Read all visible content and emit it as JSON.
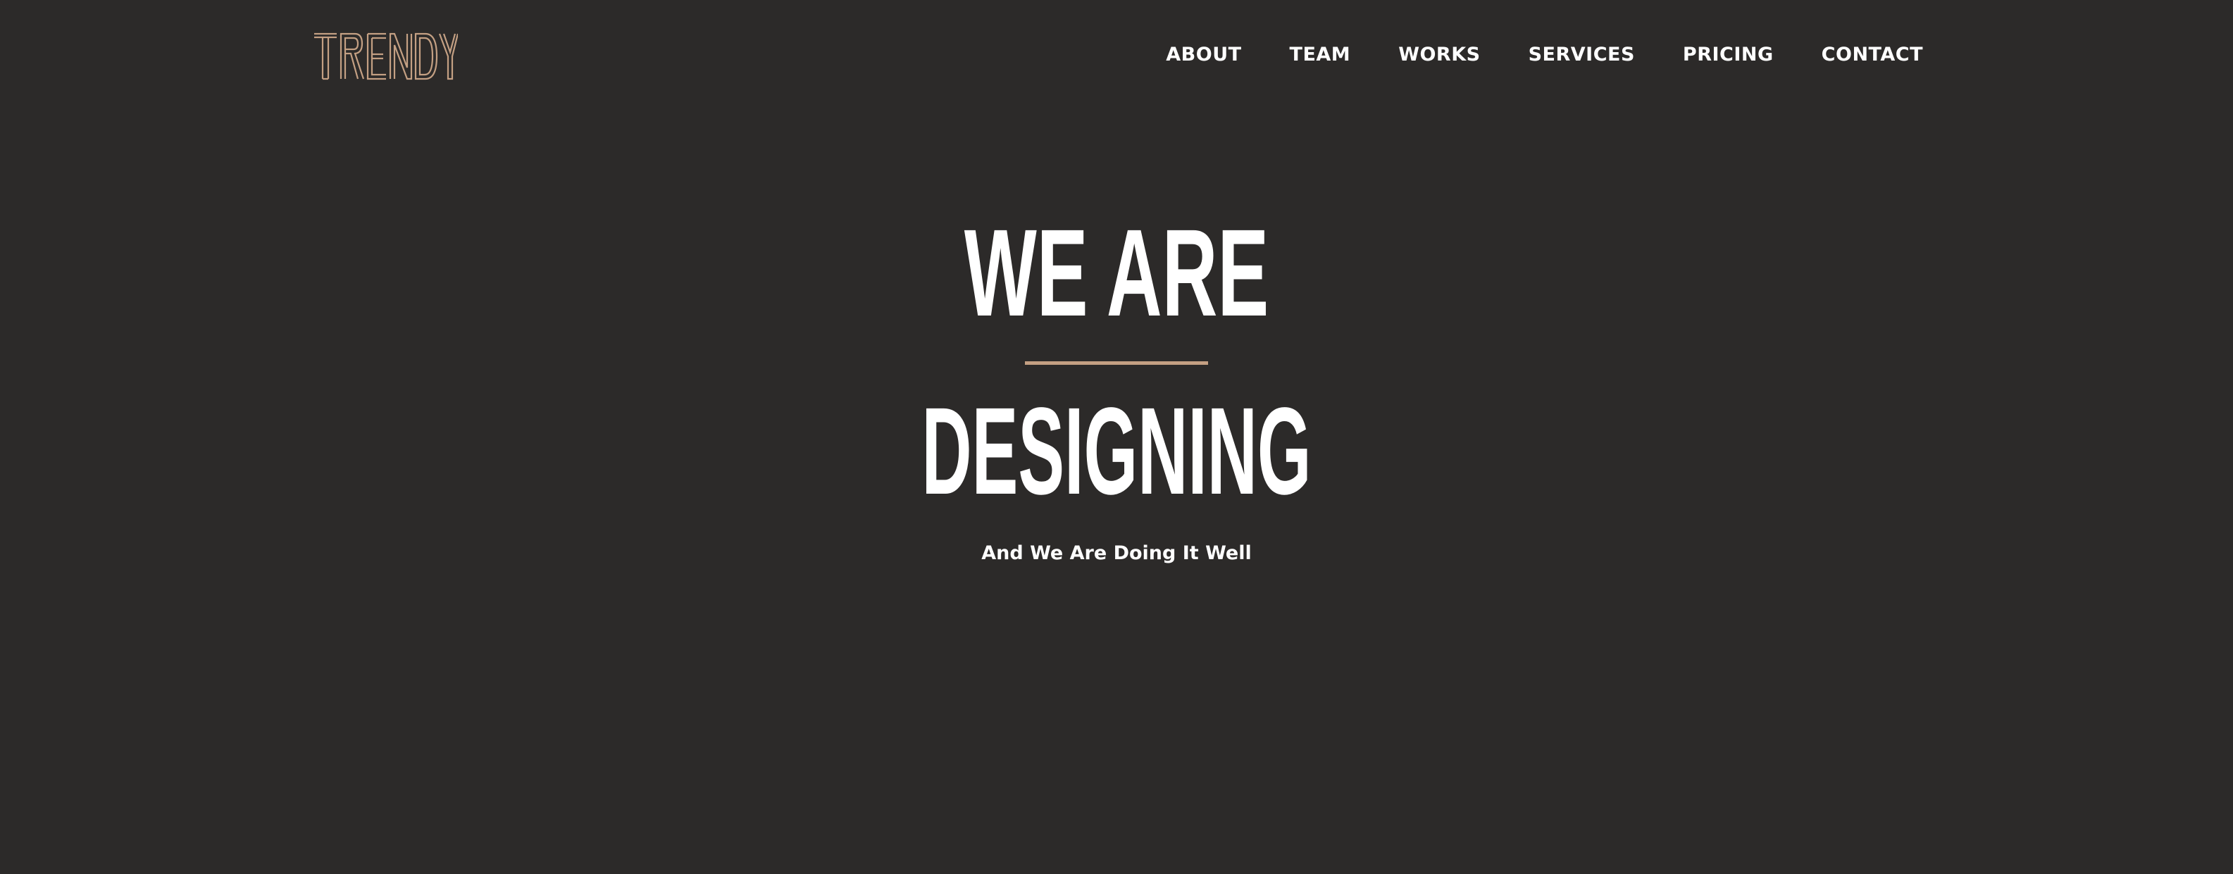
{
  "brand": {
    "logo_text": "TRENDY",
    "accent_color": "#c4a083"
  },
  "nav": {
    "items": [
      {
        "label": "ABOUT"
      },
      {
        "label": "TEAM"
      },
      {
        "label": "WORKS"
      },
      {
        "label": "SERVICES"
      },
      {
        "label": "PRICING"
      },
      {
        "label": "CONTACT"
      }
    ]
  },
  "hero": {
    "headline_top": "WE ARE",
    "headline_bottom": "DESIGNING",
    "tagline": "And We Are Doing It Well"
  },
  "colors": {
    "background": "#2c2a29",
    "text": "#ffffff",
    "accent": "#c4a083"
  }
}
